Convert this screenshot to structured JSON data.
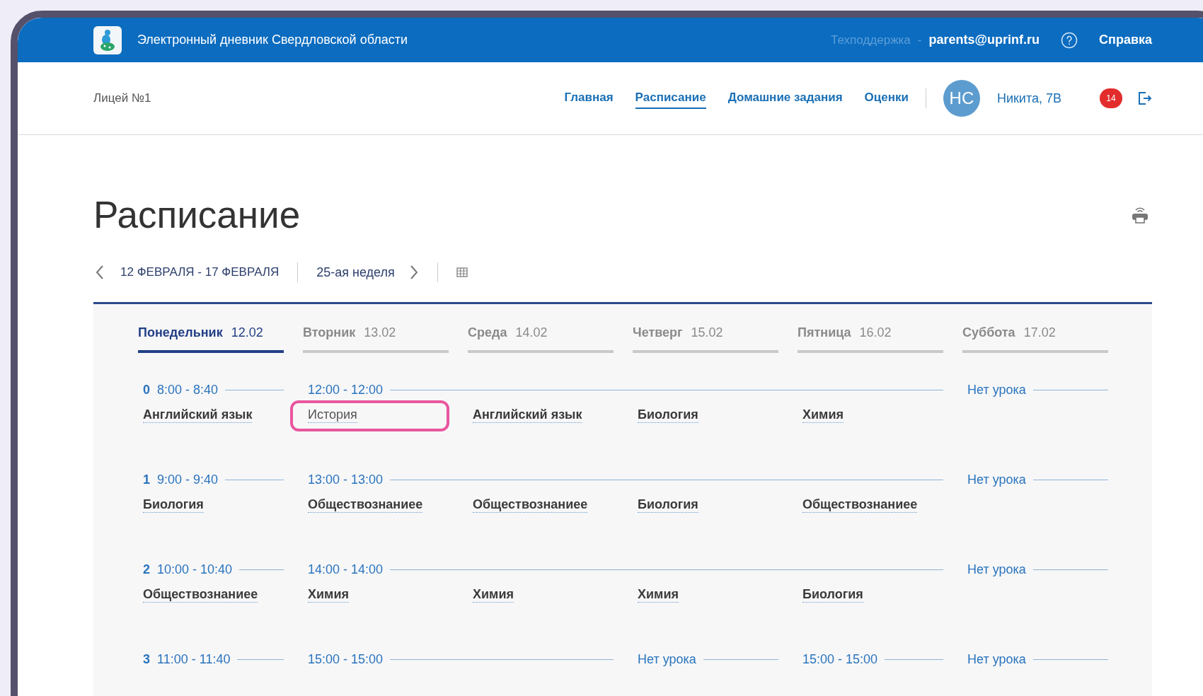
{
  "header": {
    "title": "Электронный дневник Свердловской области",
    "support_label": "Техподдержка",
    "separator": "-",
    "support_email": "parents@uprinf.ru",
    "help_link": "Справка"
  },
  "school": "Лицей №1",
  "nav": [
    {
      "label": "Главная",
      "selected": false
    },
    {
      "label": "Расписание",
      "selected": true
    },
    {
      "label": "Домашние задания",
      "selected": false
    },
    {
      "label": "Оценки",
      "selected": false
    }
  ],
  "user": {
    "initials": "НС",
    "name": "Никита, 7В",
    "notifications": "14"
  },
  "page_title": "Расписание",
  "week": {
    "range": "12 ФЕВРАЛЯ - 17 ФЕВРАЛЯ",
    "label": "25-ая неделя"
  },
  "days": [
    {
      "name": "Понедельник",
      "date": "12.02",
      "selected": true
    },
    {
      "name": "Вторник",
      "date": "13.02",
      "selected": false
    },
    {
      "name": "Среда",
      "date": "14.02",
      "selected": false
    },
    {
      "name": "Четверг",
      "date": "15.02",
      "selected": false
    },
    {
      "name": "Пятница",
      "date": "16.02",
      "selected": false
    },
    {
      "name": "Суббота",
      "date": "17.02",
      "selected": false
    }
  ],
  "slots": [
    {
      "number": "0",
      "headers": [
        {
          "kind": "time",
          "text": "8:00 - 8:40"
        },
        {
          "kind": "time",
          "text": "12:00 - 12:00"
        },
        {
          "kind": "continued"
        },
        {
          "kind": "continued"
        },
        {
          "kind": "continued"
        },
        {
          "kind": "time",
          "text": "Нет урока"
        }
      ],
      "lessons": [
        {
          "subject": "Английский язык",
          "highlighted": false
        },
        {
          "subject": "История",
          "highlighted": true
        },
        {
          "subject": "Английский язык",
          "highlighted": false
        },
        {
          "subject": "Биология",
          "highlighted": false
        },
        {
          "subject": "Химия",
          "highlighted": false
        }
      ]
    },
    {
      "number": "1",
      "headers": [
        {
          "kind": "time",
          "text": "9:00 - 9:40"
        },
        {
          "kind": "time",
          "text": "13:00 - 13:00"
        },
        {
          "kind": "continued"
        },
        {
          "kind": "continued"
        },
        {
          "kind": "continued"
        },
        {
          "kind": "time",
          "text": "Нет урока"
        }
      ],
      "lessons": [
        {
          "subject": "Биология",
          "highlighted": false
        },
        {
          "subject": "Обществознаниее",
          "highlighted": false
        },
        {
          "subject": "Обществознаниее",
          "highlighted": false
        },
        {
          "subject": "Биология",
          "highlighted": false
        },
        {
          "subject": "Обществознаниее",
          "highlighted": false
        }
      ]
    },
    {
      "number": "2",
      "headers": [
        {
          "kind": "time",
          "text": "10:00 - 10:40"
        },
        {
          "kind": "time",
          "text": "14:00 - 14:00"
        },
        {
          "kind": "continued"
        },
        {
          "kind": "continued"
        },
        {
          "kind": "continued"
        },
        {
          "kind": "time",
          "text": "Нет урока"
        }
      ],
      "lessons": [
        {
          "subject": "Обществознаниее",
          "highlighted": false
        },
        {
          "subject": "Химия",
          "highlighted": false
        },
        {
          "subject": "Химия",
          "highlighted": false
        },
        {
          "subject": "Химия",
          "highlighted": false
        },
        {
          "subject": "Биология",
          "highlighted": false
        }
      ]
    },
    {
      "number": "3",
      "headers": [
        {
          "kind": "time",
          "text": "11:00 - 11:40"
        },
        {
          "kind": "time",
          "text": "15:00 - 15:00"
        },
        {
          "kind": "continued"
        },
        {
          "kind": "time",
          "text": "Нет урока"
        },
        {
          "kind": "time",
          "text": "15:00 - 15:00"
        },
        {
          "kind": "time",
          "text": "Нет урока"
        }
      ]
    }
  ]
}
